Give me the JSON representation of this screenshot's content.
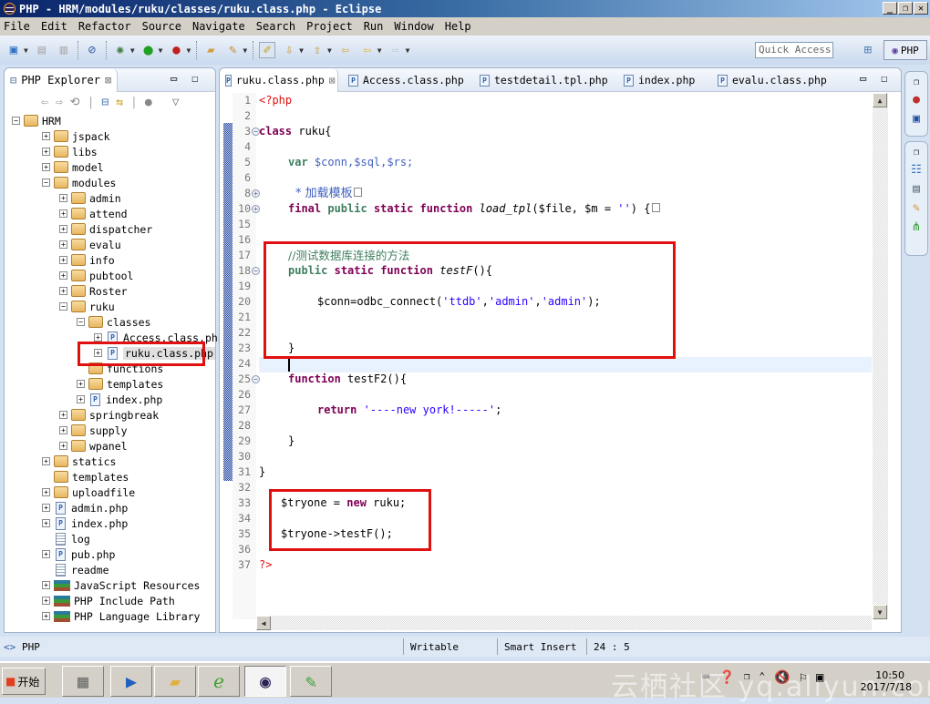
{
  "window": {
    "title": "PHP - HRM/modules/ruku/classes/ruku.class.php - Eclipse",
    "minimize": "_",
    "restore": "❐",
    "close": "✕"
  },
  "menu": [
    "File",
    "Edit",
    "Refactor",
    "Source",
    "Navigate",
    "Search",
    "Project",
    "Run",
    "Window",
    "Help"
  ],
  "toolbar": {
    "quick_access_placeholder": "Quick Access",
    "perspective_label": "PHP"
  },
  "explorer": {
    "title": "PHP Explorer",
    "close": "⊠",
    "tree": [
      {
        "label": "HRM",
        "depth": 0,
        "type": "project",
        "expander": "−"
      },
      {
        "label": "jspack",
        "depth": 1,
        "type": "folder",
        "expander": "+"
      },
      {
        "label": "libs",
        "depth": 1,
        "type": "folder",
        "expander": "+"
      },
      {
        "label": "model",
        "depth": 1,
        "type": "folder",
        "expander": "+"
      },
      {
        "label": "modules",
        "depth": 1,
        "type": "folder",
        "expander": "−"
      },
      {
        "label": "admin",
        "depth": 2,
        "type": "folder",
        "expander": "+"
      },
      {
        "label": "attend",
        "depth": 2,
        "type": "folder",
        "expander": "+"
      },
      {
        "label": "dispatcher",
        "depth": 2,
        "type": "folder",
        "expander": "+"
      },
      {
        "label": "evalu",
        "depth": 2,
        "type": "folder",
        "expander": "+"
      },
      {
        "label": "info",
        "depth": 2,
        "type": "folder",
        "expander": "+"
      },
      {
        "label": "pubtool",
        "depth": 2,
        "type": "folder",
        "expander": "+"
      },
      {
        "label": "Roster",
        "depth": 2,
        "type": "folder",
        "expander": "+"
      },
      {
        "label": "ruku",
        "depth": 2,
        "type": "folder",
        "expander": "−"
      },
      {
        "label": "classes",
        "depth": 3,
        "type": "folder",
        "expander": "−"
      },
      {
        "label": "Access.class.php",
        "depth": 4,
        "type": "php",
        "expander": "+"
      },
      {
        "label": "ruku.class.php",
        "depth": 4,
        "type": "php",
        "expander": "+",
        "selected": true
      },
      {
        "label": "functions",
        "depth": 3,
        "type": "folder",
        "expander": ""
      },
      {
        "label": "templates",
        "depth": 3,
        "type": "folder",
        "expander": "+"
      },
      {
        "label": "index.php",
        "depth": 3,
        "type": "php",
        "expander": "+"
      },
      {
        "label": "springbreak",
        "depth": 2,
        "type": "folder",
        "expander": "+"
      },
      {
        "label": "supply",
        "depth": 2,
        "type": "folder",
        "expander": "+"
      },
      {
        "label": "wpanel",
        "depth": 2,
        "type": "folder",
        "expander": "+"
      },
      {
        "label": "statics",
        "depth": 1,
        "type": "folder",
        "expander": "+"
      },
      {
        "label": "templates",
        "depth": 1,
        "type": "folder",
        "expander": ""
      },
      {
        "label": "uploadfile",
        "depth": 1,
        "type": "folder",
        "expander": "+"
      },
      {
        "label": "admin.php",
        "depth": 1,
        "type": "php",
        "expander": "+"
      },
      {
        "label": "index.php",
        "depth": 1,
        "type": "php",
        "expander": "+"
      },
      {
        "label": "log",
        "depth": 1,
        "type": "text",
        "expander": ""
      },
      {
        "label": "pub.php",
        "depth": 1,
        "type": "php",
        "expander": "+"
      },
      {
        "label": "readme",
        "depth": 1,
        "type": "text",
        "expander": ""
      },
      {
        "label": "JavaScript Resources",
        "depth": 1,
        "type": "lib",
        "expander": "+"
      },
      {
        "label": "PHP Include Path",
        "depth": 1,
        "type": "lib",
        "expander": "+"
      },
      {
        "label": "PHP Language Library",
        "depth": 1,
        "type": "lib",
        "expander": "+"
      }
    ]
  },
  "editor": {
    "tabs": [
      {
        "label": "ruku.class.php",
        "active": true,
        "close": "⊠"
      },
      {
        "label": "Access.class.php"
      },
      {
        "label": "testdetail.tpl.php"
      },
      {
        "label": "index.php"
      },
      {
        "label": "evalu.class.php"
      }
    ],
    "lines": [
      {
        "n": "1",
        "fold": ""
      },
      {
        "n": "2",
        "fold": ""
      },
      {
        "n": "3",
        "fold": "−"
      },
      {
        "n": "4",
        "fold": ""
      },
      {
        "n": "5",
        "fold": ""
      },
      {
        "n": "6",
        "fold": ""
      },
      {
        "n": "8",
        "fold": "+"
      },
      {
        "n": "10",
        "fold": "+"
      },
      {
        "n": "15",
        "fold": ""
      },
      {
        "n": "16",
        "fold": ""
      },
      {
        "n": "17",
        "fold": ""
      },
      {
        "n": "18",
        "fold": "−"
      },
      {
        "n": "19",
        "fold": ""
      },
      {
        "n": "20",
        "fold": ""
      },
      {
        "n": "21",
        "fold": ""
      },
      {
        "n": "22",
        "fold": ""
      },
      {
        "n": "23",
        "fold": ""
      },
      {
        "n": "24",
        "fold": ""
      },
      {
        "n": "25",
        "fold": "−"
      },
      {
        "n": "26",
        "fold": ""
      },
      {
        "n": "27",
        "fold": ""
      },
      {
        "n": "28",
        "fold": ""
      },
      {
        "n": "29",
        "fold": ""
      },
      {
        "n": "30",
        "fold": ""
      },
      {
        "n": "31",
        "fold": ""
      },
      {
        "n": "32",
        "fold": ""
      },
      {
        "n": "33",
        "fold": ""
      },
      {
        "n": "34",
        "fold": ""
      },
      {
        "n": "35",
        "fold": ""
      },
      {
        "n": "36",
        "fold": ""
      },
      {
        "n": "37",
        "fold": ""
      }
    ],
    "code": {
      "l1": "<?php",
      "l3_kw": "class",
      "l3_rest": " ruku{",
      "l5_kw": "var",
      "l5_rest": " $conn,$sql,$rs;",
      "l8": "* 加载模板",
      "l10_kw1": "final",
      "l10_kw2": "public",
      "l10_kw3": "static",
      "l10_kw4": "function",
      "l10_fn": "load_tpl",
      "l10_args": "($file, $m = ",
      "l10_str": "''",
      "l10_end": ") {",
      "l17": "//测试数据库连接的方法",
      "l18_kw1": "public",
      "l18_kw2": "static",
      "l18_kw3": "function",
      "l18_fn": "testF",
      "l18_end": "(){",
      "l20_a": "$conn=odbc_connect(",
      "l20_s1": "'ttdb'",
      "l20_s2": "'admin'",
      "l20_s3": "'admin'",
      "l20_end": ");",
      "comma": ",",
      "l23": "}",
      "l25_kw": "function",
      "l25_rest": " testF2(){",
      "l27_kw": "return",
      "l27_str": "'----new york!-----'",
      "l27_end": ";",
      "l29": "}",
      "l31": "}",
      "l33_a": "$tryone = ",
      "l33_kw": "new",
      "l33_end": " ruku;",
      "l35": "$tryone->testF();",
      "l37": "?>"
    }
  },
  "status": {
    "mode": "PHP",
    "writable": "Writable",
    "insert": "Smart Insert",
    "position": "24 : 5"
  },
  "taskbar": {
    "start": "开始",
    "time": "10:50",
    "date": "2017/7/18",
    "watermark": "云栖社区 yq.aliyun.com"
  }
}
